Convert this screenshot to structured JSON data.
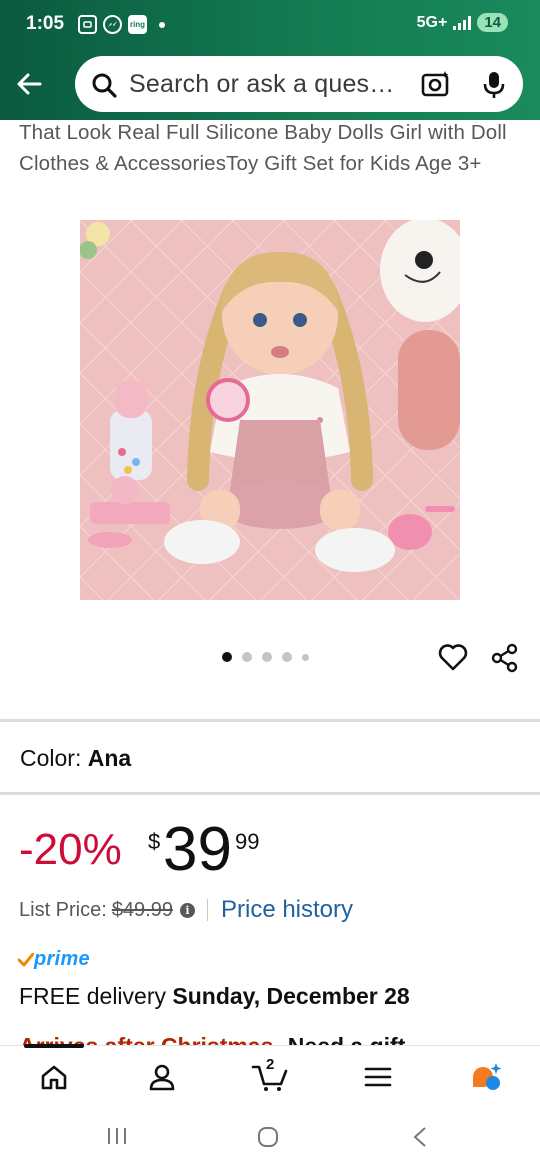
{
  "status_bar": {
    "time": "1:05",
    "notification_icons": [
      "screenshot-icon",
      "messenger-icon",
      "ring-icon"
    ],
    "ring_label": "ring",
    "network": "5G+",
    "battery": "14"
  },
  "header": {
    "back_icon": "back-arrow-icon",
    "search_placeholder": "Search or ask a ques…",
    "camera_icon": "camera-search-icon",
    "mic_icon": "microphone-icon",
    "colors": {
      "header_start": "#0b5a3f",
      "header_end": "#1a8a5c"
    }
  },
  "product": {
    "title": "That Look Real Full Silicone Baby Dolls Girl with Doll Clothes & AccessoriesToy Gift Set for Kids Age 3+",
    "image_alt": "Silicone baby doll with blonde braids in pink outfit",
    "carousel": {
      "count": 5,
      "active_index": 0
    },
    "color_label": "Color:",
    "color_value": "Ana",
    "discount": "-20%",
    "price_symbol": "$",
    "price_whole": "39",
    "price_fraction": "99",
    "list_price_label": "List Price:",
    "list_price_value": "$49.99",
    "price_history_label": "Price history",
    "prime_label": "prime",
    "delivery_prefix": "FREE delivery",
    "delivery_date": "Sunday, December 28",
    "arrival_note_red": "Arrives after Christmas.",
    "arrival_note_black": "Need a gift"
  },
  "accent_colors": {
    "discount": "#cc0c39",
    "link": "#2162a1",
    "prime": "#1a98ff"
  },
  "bottom_nav": {
    "items": [
      "home-icon",
      "account-icon",
      "cart-icon",
      "menu-icon",
      "rufus-ai-icon"
    ],
    "cart_count": "2"
  },
  "system_nav": [
    "recents-button",
    "home-button",
    "back-button"
  ]
}
